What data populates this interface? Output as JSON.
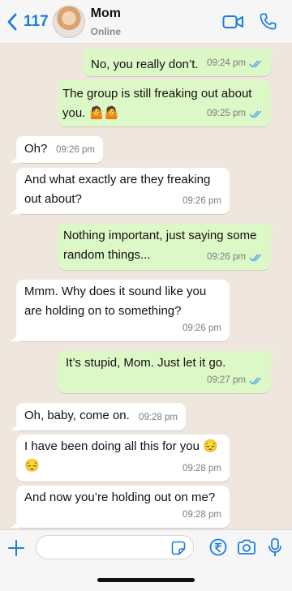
{
  "header": {
    "back_count": "117",
    "contact_name": "Mom",
    "contact_status": "Online",
    "icons": [
      "chevron-left-icon",
      "avatar",
      "video-call-icon",
      "phone-icon"
    ]
  },
  "messages": [
    {
      "dir": "out",
      "text": "No, you really don’t.",
      "time": "09:24 pm",
      "read": true
    },
    {
      "dir": "out",
      "text": "The group is still freaking out about\nyou. 🤷🤷",
      "time": "09:25 pm",
      "read": true
    },
    {
      "dir": "in",
      "text": "Oh?",
      "time": "09:26 pm"
    },
    {
      "dir": "in",
      "text": "And what exactly are they freaking\nout about?",
      "time": "09:26 pm"
    },
    {
      "dir": "out",
      "text": "Nothing important, just saying some\nrandom things...",
      "time": "09:26 pm",
      "read": true
    },
    {
      "dir": "in",
      "text": "Mmm. Why does it sound like you\nare holding on to something?",
      "time": "09:26 pm"
    },
    {
      "dir": "out",
      "text": "It’s stupid, Mom. Just let it go.",
      "time": "09:27 pm",
      "read": true
    },
    {
      "dir": "in",
      "text": "Oh, baby, come on.",
      "time": "09:28 pm"
    },
    {
      "dir": "in",
      "text": "I have been doing all this for you 😔\n😔",
      "time": "09:28 pm"
    },
    {
      "dir": "in",
      "text": "And now you’re holding out on me?",
      "time": "09:28 pm"
    }
  ],
  "composer": {
    "placeholder": "",
    "icons": [
      "plus-icon",
      "sticker-icon",
      "rupee-payment-icon",
      "camera-icon",
      "microphone-icon"
    ]
  },
  "colors": {
    "accent": "#1a7de0",
    "incoming_bubble": "#ffffff",
    "outgoing_bubble": "#dcf8c6",
    "chat_background": "#efe7de",
    "read_ticks": "#4fa3e8"
  }
}
